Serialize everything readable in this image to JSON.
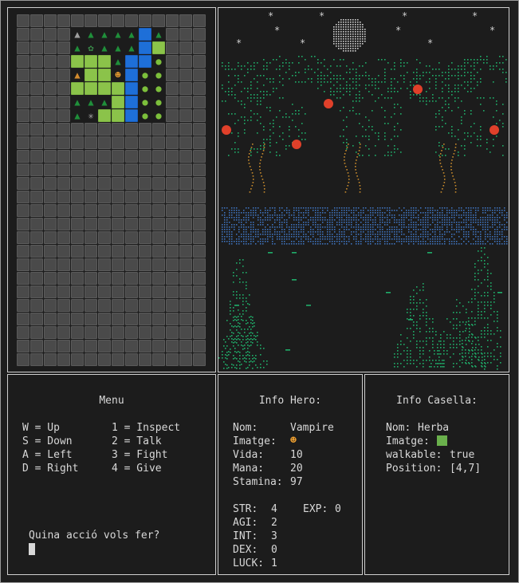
{
  "colors": {
    "wall": "#4a4a4a",
    "grass": "#8bc34a",
    "water": "#1e6fd8",
    "tree": "#1f8f3a",
    "ascii_green": "#1fae6a",
    "ascii_river": "#3f78c8",
    "ascii_trunk": "#c78a2c",
    "apple": "#e0402a"
  },
  "map": {
    "rows": [
      "WWWWWWWWWWWWWW",
      "WWWWMTTTTVTWWW",
      "WWWWTPTTTVGWWW",
      "WWWWGGGTVVRWWW",
      "WWWWNGGHVRRWWW",
      "WWWWGGGGVRRWWW",
      "WWWWTTTGVRRWWW",
      "WWWWTSGGVRRWWW",
      "WWWWWWWWWWWWWW",
      "WWWWWWWWWWWWWW",
      "WWWWWWWWWWWWWW",
      "WWWWWWWWWWWWWW",
      "WWWWWWWWWWWWWW",
      "WWWWWWWWWWWWWW",
      "WWWWWWWWWWWWWW",
      "WWWWWWWWWWWWWW",
      "WWWWWWWWWWWWWW",
      "WWWWWWWWWWWWWW",
      "WWWWWWWWWWWWWW",
      "WWWWWWWWWWWWWW",
      "WWWWWWWWWWWWWW",
      "WWWWWWWWWWWWWW",
      "WWWWWWWWWWWWWW",
      "WWWWWWWWWWWWWW",
      "WWWWWWWWWWWWWW",
      "WWWWWWWWWWWWWW"
    ],
    "legend": {
      "W": "wall",
      "G": "grass",
      "V": "water",
      "T": "tree",
      "R": "round",
      "H": "hero",
      "M": "mtn",
      "N": "tent",
      "S": "spider",
      "P": "plant"
    }
  },
  "menu": {
    "title": "Menu",
    "left": [
      "W = Up",
      "S = Down",
      "A = Left",
      "D = Right"
    ],
    "right": [
      "1 = Inspect",
      "2 = Talk",
      "3 = Fight",
      "4 = Give"
    ],
    "prompt": "Quina acció vols fer?"
  },
  "hero": {
    "title": "Info Hero:",
    "nom_label": "Nom:",
    "nom": "Vampire",
    "imatge_label": "Imatge:",
    "vida_label": "Vida:",
    "vida": "10",
    "mana_label": "Mana:",
    "mana": "20",
    "stamina_label": "Stamina:",
    "stamina": "97",
    "str_label": "STR:",
    "str": "4",
    "exp_label": "EXP:",
    "exp": "0",
    "agi_label": "AGI:",
    "agi": "2",
    "int_label": "INT:",
    "int": "3",
    "dex_label": "DEX:",
    "dex": "0",
    "luck_label": "LUCK:",
    "luck": "1"
  },
  "cell": {
    "title": "Info Casella:",
    "nom_label": "Nom:",
    "nom": "Herba",
    "imatge_label": "Imatge:",
    "walkable_label": "walkable:",
    "walkable": "true",
    "position_label": "Position:",
    "position": "[4,7]"
  }
}
